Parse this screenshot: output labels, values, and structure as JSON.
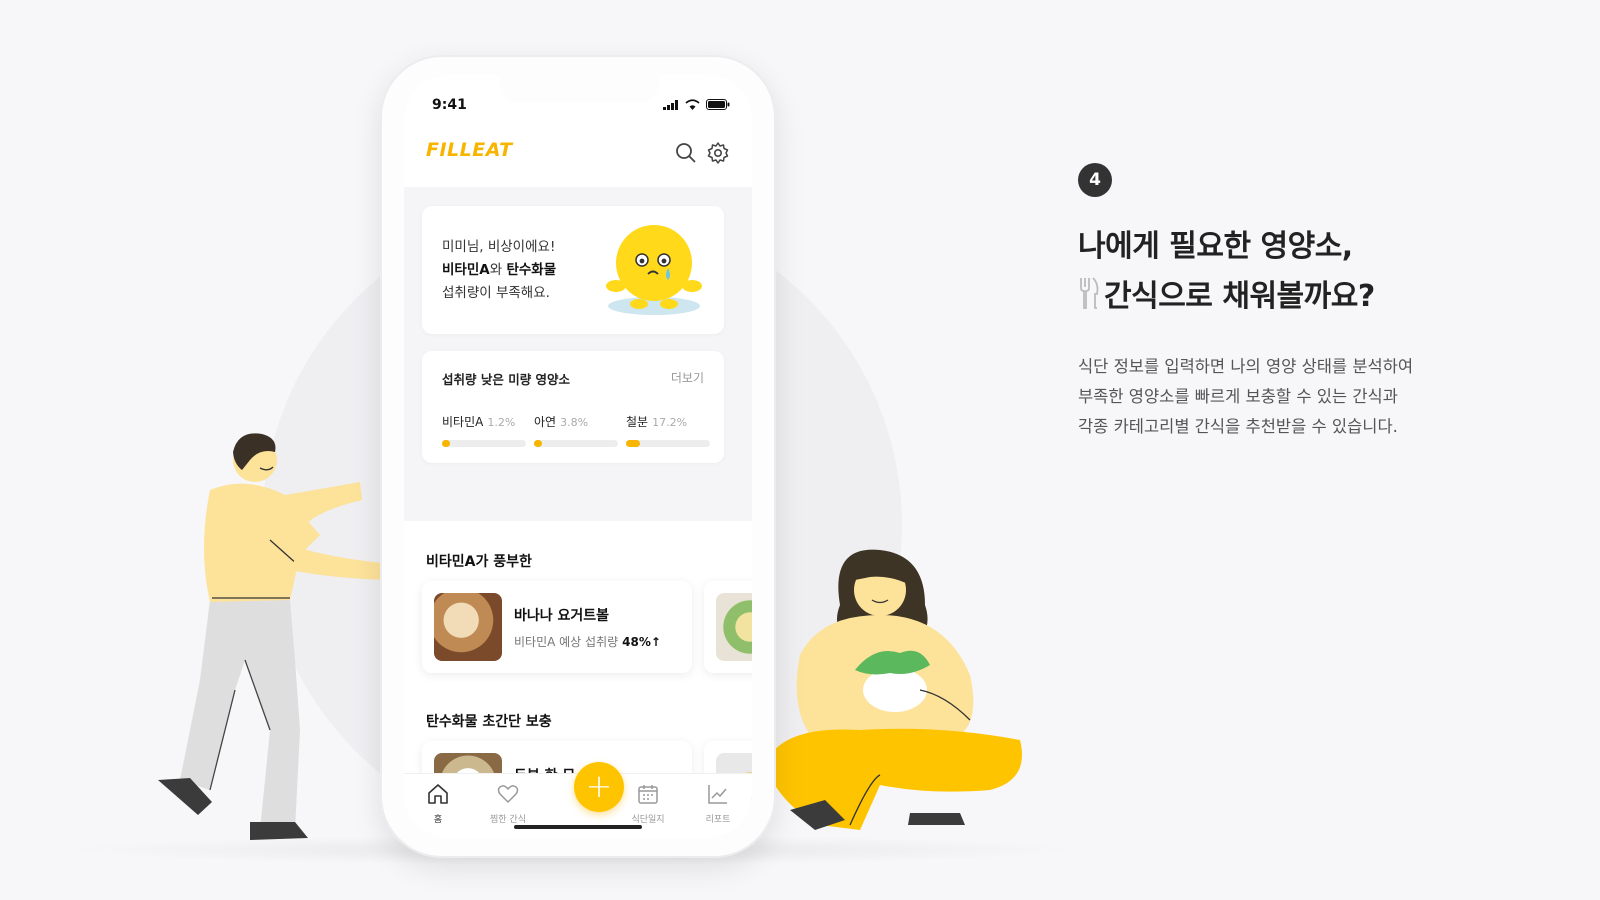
{
  "phone": {
    "time": "9:41",
    "app_name": "FILLEAT",
    "alert": {
      "line1": "미미님, 비상이에요!",
      "nutrient_a": "비타민A",
      "connector": "와 ",
      "nutrient_b": "탄수화물",
      "line3": "섭취량이 부족해요."
    },
    "deficient": {
      "title": "섭취량 낮은 미량 영양소",
      "more": "더보기",
      "items": [
        {
          "name": "비타민A",
          "percent_label": "1.2%",
          "percent": 1.2
        },
        {
          "name": "아연",
          "percent_label": "3.8%",
          "percent": 3.8
        },
        {
          "name": "철분",
          "percent_label": "17.2%",
          "percent": 17.2
        }
      ]
    },
    "sections": [
      {
        "title": "비타민A가 풍부한",
        "food": {
          "name": "바나나 요거트볼",
          "sub": "비타민A 예상 섭취량",
          "value": "48%↑"
        }
      },
      {
        "title": "탄수화물 초간단 보충",
        "food": {
          "name": "두부 한 모"
        }
      }
    ],
    "tabs": [
      {
        "label": "홈",
        "icon": "home-icon"
      },
      {
        "label": "찜한 간식",
        "icon": "heart-icon"
      },
      {
        "label": "식단일지",
        "icon": "calendar-icon"
      },
      {
        "label": "리포트",
        "icon": "chart-icon"
      }
    ],
    "fab_label": "+"
  },
  "info": {
    "step": "4",
    "headline_line1": "나에게 필요한 영양소,",
    "headline_line2": "간식으로 채워볼까요?",
    "desc_line1": "식단 정보를 입력하면 나의 영양 상태를 분석하여",
    "desc_line2": "부족한 영양소를 빠르게 보충할 수 있는 간식과",
    "desc_line3": "각종 카테고리별 간식을 추천받을 수 있습니다."
  },
  "colors": {
    "accent": "#ffc400",
    "brand_text": "#f7b500",
    "background": "#f7f7f9"
  }
}
